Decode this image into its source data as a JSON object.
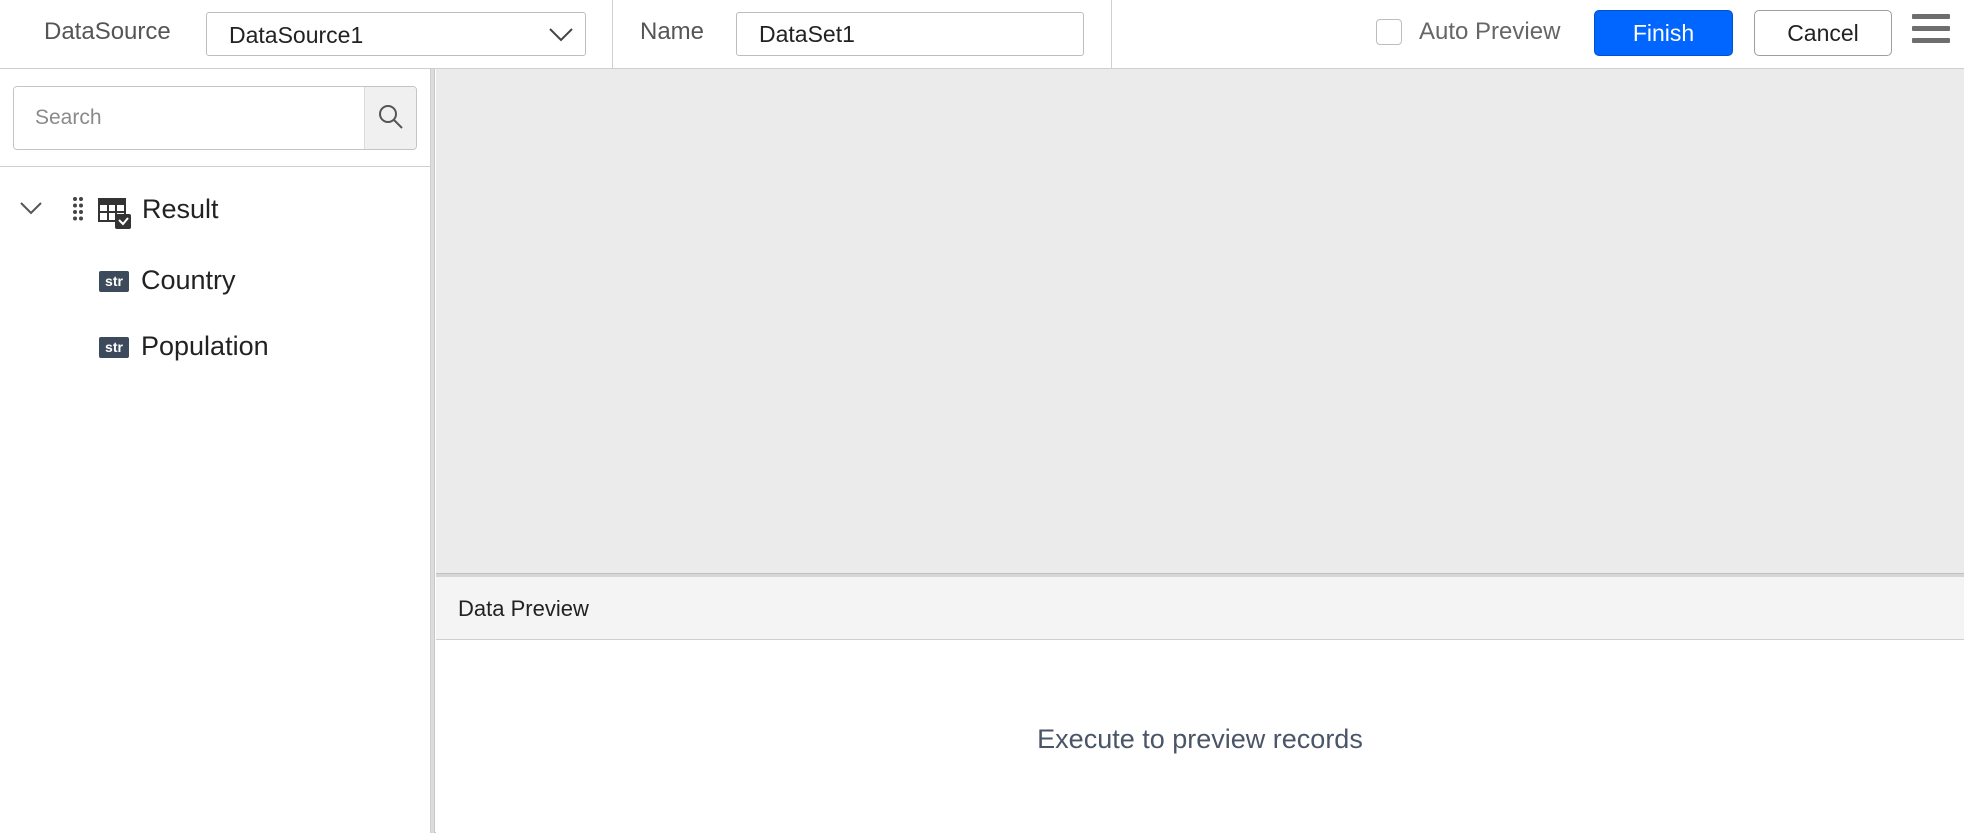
{
  "toolbar": {
    "datasource_label": "DataSource",
    "datasource_value": "DataSource1",
    "name_label": "Name",
    "name_value": "DataSet1",
    "auto_preview_label": "Auto Preview",
    "auto_preview_checked": false,
    "finish_label": "Finish",
    "cancel_label": "Cancel",
    "menu_icon": "hamburger-icon"
  },
  "sidebar": {
    "search_placeholder": "Search",
    "search_icon": "search-icon",
    "tree": {
      "root": {
        "label": "Result",
        "expanded": true,
        "icon": "table-icon"
      },
      "fields": [
        {
          "label": "Country",
          "type_badge": "str"
        },
        {
          "label": "Population",
          "type_badge": "str"
        }
      ]
    }
  },
  "preview": {
    "title": "Data Preview",
    "empty_message": "Execute to preview records"
  },
  "colors": {
    "primary": "#0066ff",
    "canvas_bg": "#ebebeb",
    "badge_bg": "#3c4a5c"
  }
}
